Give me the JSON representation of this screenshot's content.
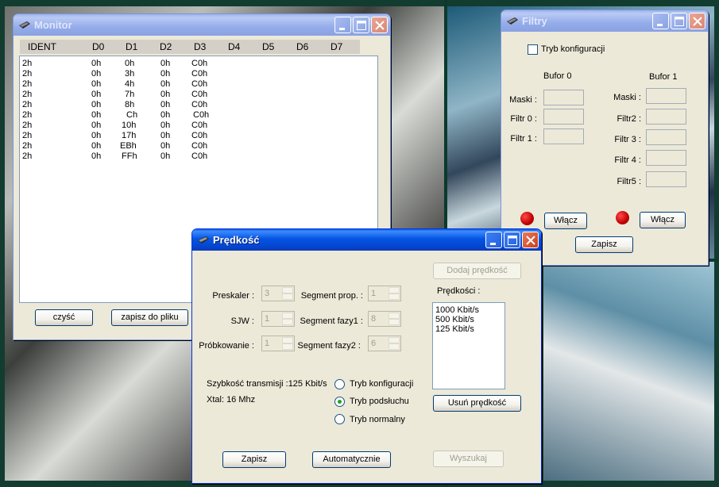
{
  "monitor": {
    "title": "Monitor",
    "columns": [
      "IDENT",
      "D0",
      "D1",
      "D2",
      "D3",
      "D4",
      "D5",
      "D6",
      "D7"
    ],
    "rows": [
      [
        "2h",
        "0h",
        "0h",
        "0h",
        "C0h"
      ],
      [
        "2h",
        "0h",
        "3h",
        "0h",
        "C0h"
      ],
      [
        "2h",
        "0h",
        "4h",
        "0h",
        "C0h"
      ],
      [
        "2h",
        "0h",
        "7h",
        "0h",
        "C0h"
      ],
      [
        "2h",
        "0h",
        "8h",
        "0h",
        "C0h"
      ],
      [
        "2h",
        "0h",
        "Ch",
        "0h",
        "C0h"
      ],
      [
        "2h",
        "0h",
        "10h",
        "0h",
        "C0h"
      ],
      [
        "2h",
        "0h",
        "17h",
        "0h",
        "C0h"
      ],
      [
        "2h",
        "0h",
        "EBh",
        "0h",
        "C0h"
      ],
      [
        "2h",
        "0h",
        "FFh",
        "0h",
        "C0h"
      ]
    ],
    "clear_label": "czyść",
    "save_file_label": "zapisz do pliku"
  },
  "filtry": {
    "title": "Filtry",
    "config_checkbox_label": "Tryb konfiguracji",
    "config_checked": false,
    "buffer0": {
      "header": "Bufor 0",
      "labels": [
        "Maski :",
        "Filtr 0 :",
        "Filtr 1 :"
      ],
      "enable_label": "Włącz"
    },
    "buffer1": {
      "header": "Bufor 1",
      "labels": [
        "Maski :",
        "Filtr2 :",
        "Filtr 3 :",
        "Filtr 4 :",
        "Filtr5 :"
      ],
      "enable_label": "Włącz"
    },
    "led_color": "#cc0000",
    "save_label": "Zapisz"
  },
  "predkosc": {
    "title": "Prędkość",
    "add_speed_label": "Dodaj prędkość",
    "speeds_label": "Prędkości :",
    "speeds": [
      "1000 Kbit/s",
      "500 Kbit/s",
      "125 Kbit/s"
    ],
    "remove_speed_label": "Usuń prędkość",
    "fields": {
      "preskaler": {
        "label": "Preskaler :",
        "value": "3"
      },
      "sjw": {
        "label": "SJW :",
        "value": "1"
      },
      "probkowanie": {
        "label": "Próbkowanie :",
        "value": "1"
      },
      "segment_prop": {
        "label": "Segment prop. :",
        "value": "1"
      },
      "segment_fazy1": {
        "label": "Segment fazy1 :",
        "value": "8"
      },
      "segment_fazy2": {
        "label": "Segment fazy2 :",
        "value": "6"
      }
    },
    "transmission_speed": "Szybkość transmisji :125 Kbit/s",
    "xtal": "Xtal: 16 Mhz",
    "modes": [
      {
        "label": "Tryb konfiguracji",
        "selected": false
      },
      {
        "label": "Tryb podsłuchu",
        "selected": true
      },
      {
        "label": "Tryb normalny",
        "selected": false
      }
    ],
    "save_label": "Zapisz",
    "auto_label": "Automatycznie",
    "search_label": "Wyszukaj"
  },
  "colors": {
    "titlebar_active": "#0554e3",
    "titlebar_inactive": "#95acea",
    "window_face": "#ece9d8",
    "radio_dot": "#21a121"
  }
}
